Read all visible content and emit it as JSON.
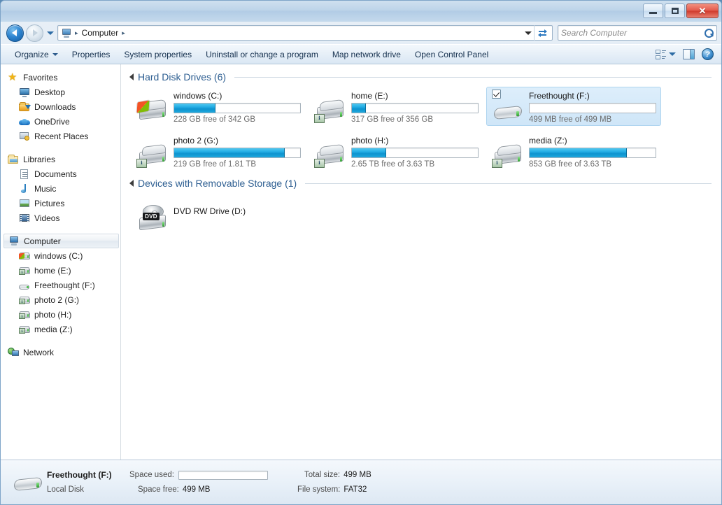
{
  "window": {
    "minimize_label": "–",
    "maximize_label": "□",
    "close_label": "✕"
  },
  "address": {
    "computer_icon": "computer-icon",
    "crumb_root": "Computer",
    "separator": "▸",
    "dropdown_icon": "chevron-down-icon",
    "refresh_icon": "refresh-icon"
  },
  "search": {
    "placeholder": "Search Computer",
    "value": "",
    "icon": "search-icon"
  },
  "toolbar": {
    "organize": "Organize",
    "properties": "Properties",
    "system_properties": "System properties",
    "uninstall": "Uninstall or change a program",
    "map_network_drive": "Map network drive",
    "open_control_panel": "Open Control Panel",
    "view_icon": "view-options-icon",
    "pane_icon": "preview-pane-icon",
    "help_icon": "help-icon",
    "help_glyph": "?"
  },
  "sidebar": {
    "groups": [
      {
        "header": {
          "label": "Favorites",
          "icon": "star-icon"
        },
        "items": [
          {
            "label": "Desktop",
            "icon": "desktop-icon"
          },
          {
            "label": "Downloads",
            "icon": "downloads-folder-icon"
          },
          {
            "label": "OneDrive",
            "icon": "onedrive-cloud-icon"
          },
          {
            "label": "Recent Places",
            "icon": "recent-places-icon"
          }
        ]
      },
      {
        "header": {
          "label": "Libraries",
          "icon": "libraries-icon"
        },
        "items": [
          {
            "label": "Documents",
            "icon": "document-icon"
          },
          {
            "label": "Music",
            "icon": "music-note-icon"
          },
          {
            "label": "Pictures",
            "icon": "picture-icon"
          },
          {
            "label": "Videos",
            "icon": "video-icon"
          }
        ]
      },
      {
        "header": {
          "label": "Computer",
          "icon": "computer-icon",
          "selected": true
        },
        "items": [
          {
            "label": "windows (C:)",
            "icon": "windows-drive-icon"
          },
          {
            "label": "home (E:)",
            "icon": "network-drive-icon"
          },
          {
            "label": "Freethought (F:)",
            "icon": "removable-drive-icon"
          },
          {
            "label": "photo 2 (G:)",
            "icon": "network-drive-icon"
          },
          {
            "label": "photo (H:)",
            "icon": "network-drive-icon"
          },
          {
            "label": "media (Z:)",
            "icon": "network-drive-icon"
          }
        ]
      },
      {
        "header": {
          "label": "Network",
          "icon": "network-icon"
        },
        "items": []
      }
    ]
  },
  "content": {
    "groups": [
      {
        "title": "Hard Disk Drives (6)",
        "collapse_icon": "collapse-triangle-icon",
        "tiles": [
          {
            "name": "windows (C:)",
            "sub": "228 GB free of 342 GB",
            "used_percent": 33,
            "icon": "windows-drive-icon",
            "selected": false,
            "low_space": false
          },
          {
            "name": "home (E:)",
            "sub": "317 GB free of 356 GB",
            "used_percent": 11,
            "icon": "network-drive-icon",
            "selected": false,
            "low_space": false
          },
          {
            "name": "Freethought (F:)",
            "sub": "499 MB free of 499 MB",
            "used_percent": 0,
            "icon": "removable-drive-icon",
            "selected": true,
            "low_space": false
          },
          {
            "name": "photo 2 (G:)",
            "sub": "219 GB free of 1.81 TB",
            "used_percent": 88,
            "icon": "network-drive-icon",
            "selected": false,
            "low_space": false
          },
          {
            "name": "photo (H:)",
            "sub": "2.65 TB free of 3.63 TB",
            "used_percent": 27,
            "icon": "network-drive-icon",
            "selected": false,
            "low_space": false
          },
          {
            "name": "media (Z:)",
            "sub": "853 GB free of 3.63 TB",
            "used_percent": 77,
            "icon": "network-drive-icon",
            "selected": false,
            "low_space": false
          }
        ]
      },
      {
        "title": "Devices with Removable Storage (1)",
        "collapse_icon": "collapse-triangle-icon",
        "tiles": [
          {
            "name": "DVD RW Drive (D:)",
            "sub": "",
            "used_percent": null,
            "icon": "dvd-drive-icon",
            "selected": false,
            "low_space": false
          }
        ]
      }
    ]
  },
  "statusbar": {
    "icon": "removable-drive-icon",
    "title": "Freethought (F:)",
    "type": "Local Disk",
    "space_used_label": "Space used:",
    "space_used_percent": 0,
    "space_free_label": "Space free:",
    "space_free_value": "499 MB",
    "total_size_label": "Total size:",
    "total_size_value": "499 MB",
    "file_system_label": "File system:",
    "file_system_value": "FAT32"
  },
  "colors": {
    "accent_blue": "#0d93cf",
    "group_title": "#2d5e91",
    "selection_fill": "#cfe6f8",
    "selection_border": "#aed4ef"
  }
}
